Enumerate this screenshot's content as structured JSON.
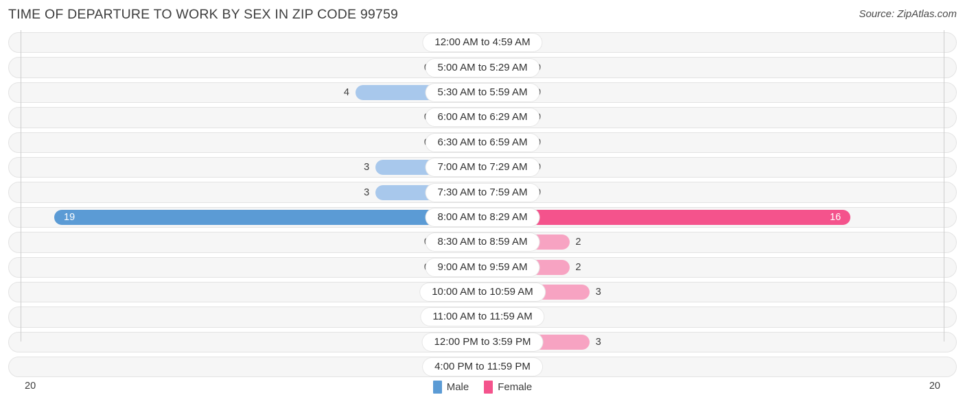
{
  "header": {
    "title": "TIME OF DEPARTURE TO WORK BY SEX IN ZIP CODE 99759",
    "source": "Source: ZipAtlas.com"
  },
  "legend": {
    "male_label": "Male",
    "female_label": "Female",
    "male_color": "#5b9bd5",
    "female_color": "#f4538c"
  },
  "axis": {
    "left_tick": "20",
    "right_tick": "20"
  },
  "colors": {
    "male_light": "#a8c8ec",
    "male_dark": "#5b9bd5",
    "female_light": "#f7a3c2",
    "female_dark": "#f4538c",
    "track": "#f6f6f6"
  },
  "chart_data": {
    "type": "bar",
    "orientation": "horizontal-diverging",
    "title": "TIME OF DEPARTURE TO WORK BY SEX IN ZIP CODE 99759",
    "xlabel": "",
    "ylabel": "",
    "xlim": [
      20,
      20
    ],
    "grid": false,
    "legend_position": "bottom-center",
    "categories": [
      "12:00 AM to 4:59 AM",
      "5:00 AM to 5:29 AM",
      "5:30 AM to 5:59 AM",
      "6:00 AM to 6:29 AM",
      "6:30 AM to 6:59 AM",
      "7:00 AM to 7:29 AM",
      "7:30 AM to 7:59 AM",
      "8:00 AM to 8:29 AM",
      "8:30 AM to 8:59 AM",
      "9:00 AM to 9:59 AM",
      "10:00 AM to 10:59 AM",
      "11:00 AM to 11:59 AM",
      "12:00 PM to 3:59 PM",
      "4:00 PM to 11:59 PM"
    ],
    "series": [
      {
        "name": "Male",
        "values": [
          0,
          0,
          4,
          0,
          0,
          3,
          3,
          19,
          0,
          0,
          0,
          0,
          0,
          0
        ]
      },
      {
        "name": "Female",
        "values": [
          0,
          0,
          0,
          0,
          0,
          0,
          0,
          16,
          2,
          2,
          3,
          0,
          3,
          0
        ]
      }
    ]
  },
  "rows": [
    {
      "label": "12:00 AM to 4:59 AM",
      "male": "0",
      "female": "0"
    },
    {
      "label": "5:00 AM to 5:29 AM",
      "male": "0",
      "female": "0"
    },
    {
      "label": "5:30 AM to 5:59 AM",
      "male": "4",
      "female": "0"
    },
    {
      "label": "6:00 AM to 6:29 AM",
      "male": "0",
      "female": "0"
    },
    {
      "label": "6:30 AM to 6:59 AM",
      "male": "0",
      "female": "0"
    },
    {
      "label": "7:00 AM to 7:29 AM",
      "male": "3",
      "female": "0"
    },
    {
      "label": "7:30 AM to 7:59 AM",
      "male": "3",
      "female": "0"
    },
    {
      "label": "8:00 AM to 8:29 AM",
      "male": "19",
      "female": "16"
    },
    {
      "label": "8:30 AM to 8:59 AM",
      "male": "0",
      "female": "2"
    },
    {
      "label": "9:00 AM to 9:59 AM",
      "male": "0",
      "female": "2"
    },
    {
      "label": "10:00 AM to 10:59 AM",
      "male": "0",
      "female": "3"
    },
    {
      "label": "11:00 AM to 11:59 AM",
      "male": "0",
      "female": "0"
    },
    {
      "label": "12:00 PM to 3:59 PM",
      "male": "0",
      "female": "3"
    },
    {
      "label": "4:00 PM to 11:59 PM",
      "male": "0",
      "female": "0"
    }
  ]
}
